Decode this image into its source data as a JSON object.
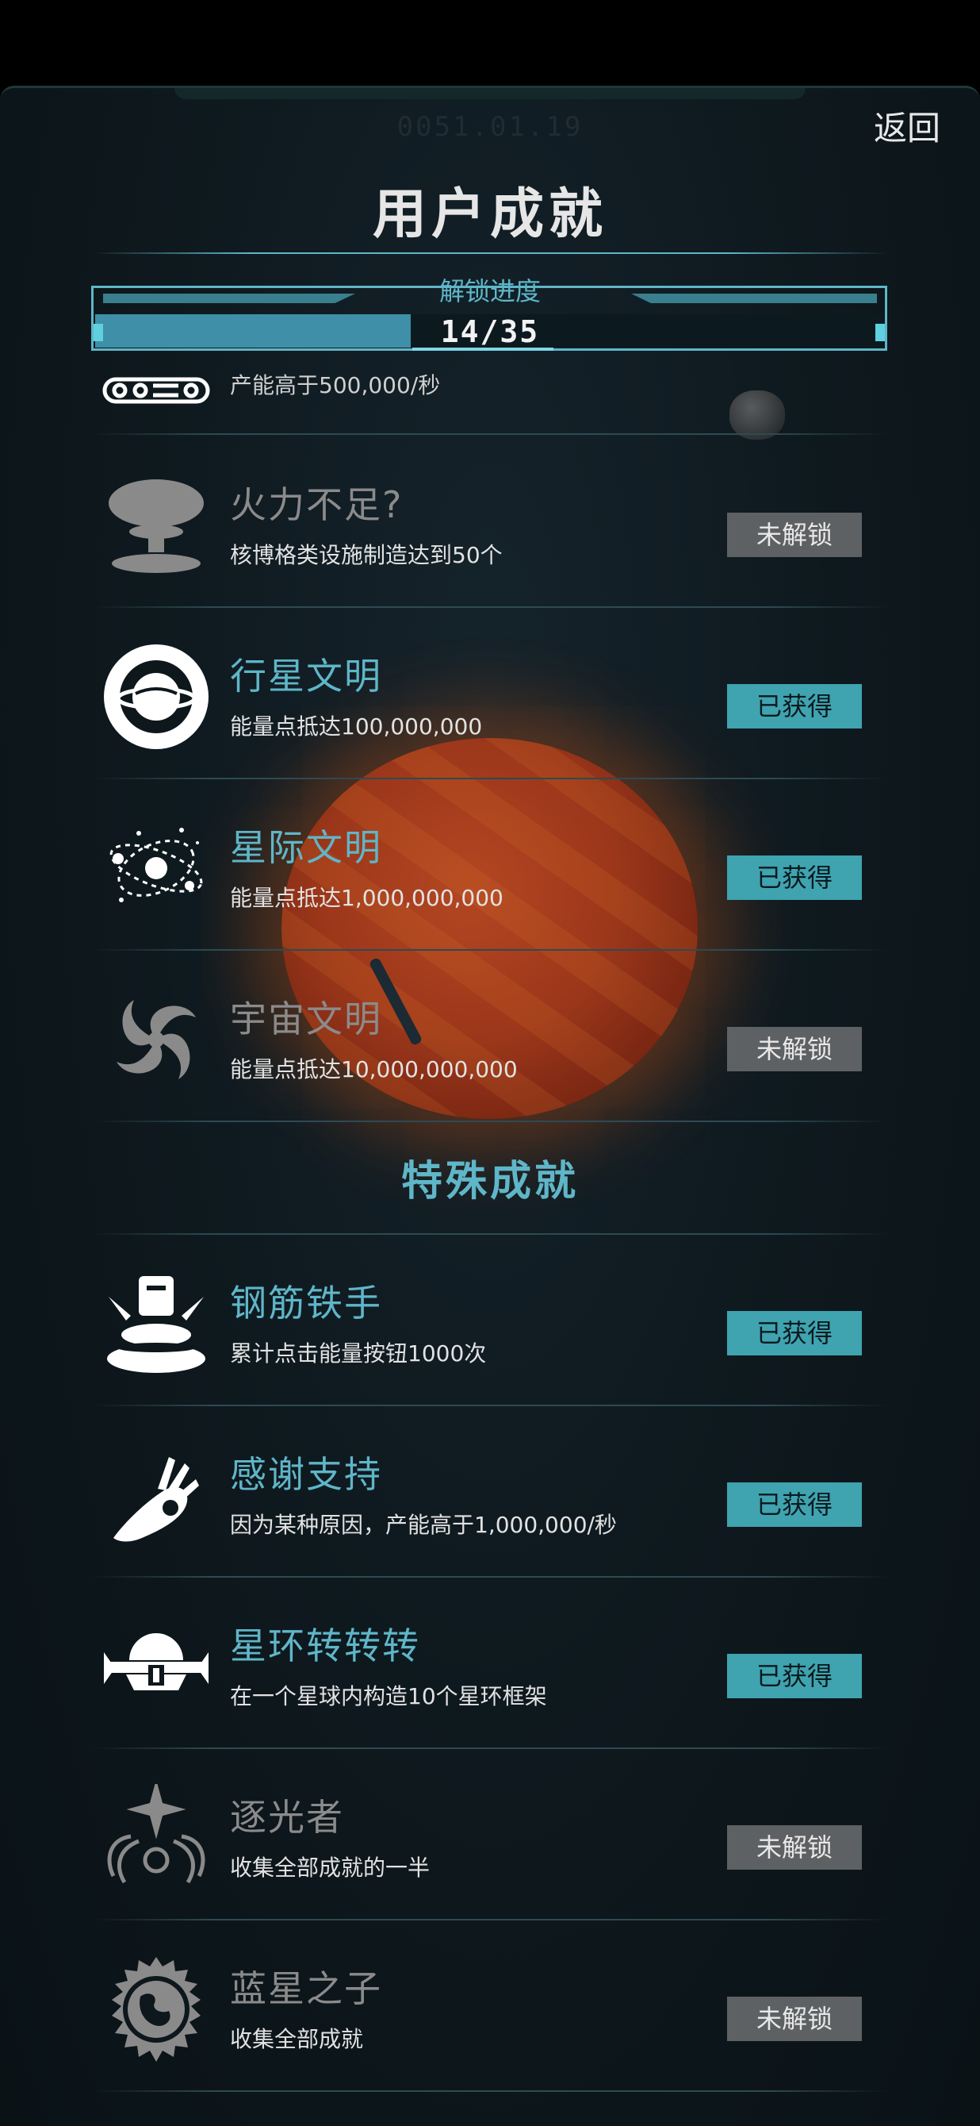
{
  "header": {
    "date": "0051.01.19",
    "back_label": "返回",
    "title": "用户成就"
  },
  "progress": {
    "label": "解锁进度",
    "text": "14/35",
    "unlocked": 14,
    "total": 35
  },
  "partial_row": {
    "desc": "产能高于500,000/秒"
  },
  "achievements": [
    {
      "name": "火力不足?",
      "desc": "核博格类设施制造达到50个",
      "status": "未解锁",
      "icon": "mushroom-cloud-icon"
    },
    {
      "name": "行星文明",
      "desc": "能量点抵达100,000,000",
      "status": "已获得",
      "icon": "planet-ring-icon"
    },
    {
      "name": "星际文明",
      "desc": "能量点抵达1,000,000,000",
      "status": "已获得",
      "icon": "atom-orbit-icon"
    },
    {
      "name": "宇宙文明",
      "desc": "能量点抵达10,000,000,000",
      "status": "未解锁",
      "icon": "spiral-galaxy-icon"
    }
  ],
  "special_section": {
    "label": "特殊成就"
  },
  "special_achievements": [
    {
      "name": "钢筋铁手",
      "desc": "累计点击能量按钮1000次",
      "status": "已获得",
      "icon": "button-press-icon"
    },
    {
      "name": "感谢支持",
      "desc": "因为某种原因，产能高于1,000,000/秒",
      "status": "已获得",
      "icon": "ok-hand-icon"
    },
    {
      "name": "星环转转转",
      "desc": "在一个星球内构造10个星环框架",
      "status": "已获得",
      "icon": "star-ring-icon"
    },
    {
      "name": "逐光者",
      "desc": "收集全部成就的一半",
      "status": "未解锁",
      "icon": "light-chaser-icon"
    },
    {
      "name": "蓝星之子",
      "desc": "收集全部成就",
      "status": "未解锁",
      "icon": "earth-emblem-icon"
    }
  ],
  "colors": {
    "accent": "#5fb6c8",
    "badge_got": "#3fa3b0",
    "badge_locked": "#5e6163"
  }
}
